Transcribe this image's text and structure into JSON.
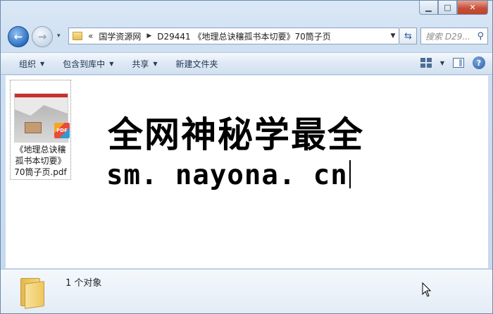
{
  "window": {
    "caption": {
      "minimize": "▁",
      "maximize": "□",
      "close": "✕"
    }
  },
  "nav": {
    "history_arrow": "▾",
    "breadcrumb": {
      "overflow": "«",
      "items": [
        "国学资源网",
        "D29441 《地理总诀穰孤书本切要》70筒子页"
      ]
    },
    "search_placeholder": "搜索 D29..."
  },
  "commands": {
    "organize": "组织",
    "include_in_library": "包含到库中",
    "share": "共享",
    "new_folder": "新建文件夹"
  },
  "file": {
    "name_line1": "《地理总诀穰",
    "name_line2": "孤书本切要》",
    "name_line3": "70筒子页.pdf",
    "badge": "PDF"
  },
  "watermark": {
    "line1": "全网神秘学最全",
    "line2": "sm. nayona. cn"
  },
  "details": {
    "count_text": "1 个对象"
  },
  "colors": {
    "accent": "#2d6fc0",
    "close_button": "#c7503a"
  }
}
